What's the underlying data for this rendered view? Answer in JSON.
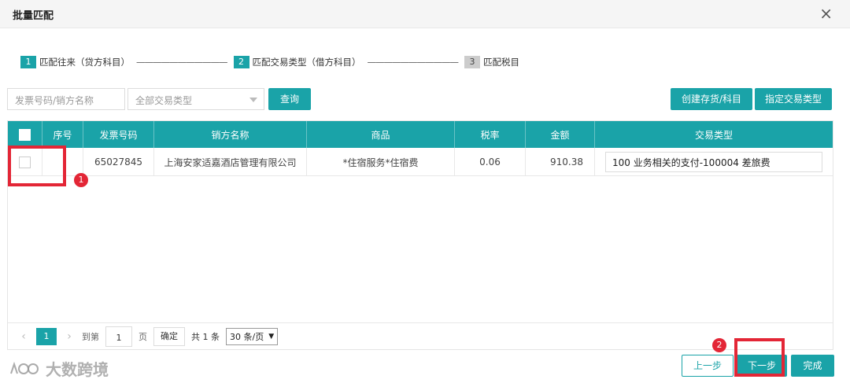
{
  "dialog": {
    "title": "批量匹配",
    "close_glyph": "×"
  },
  "steps": [
    {
      "num": "1",
      "label": "匹配往来（贷方科目）",
      "active": true
    },
    {
      "num": "2",
      "label": "匹配交易类型（借方科目）",
      "active": true
    },
    {
      "num": "3",
      "label": "匹配税目",
      "active": false
    }
  ],
  "step_separator": "———————————",
  "filters": {
    "search_placeholder": "发票号码/销方名称",
    "type_select": "全部交易类型",
    "query_label": "查询",
    "create_label": "创建存货/科目",
    "assign_label": "指定交易类型"
  },
  "table": {
    "columns": [
      "",
      "序号",
      "发票号码",
      "销方名称",
      "商品",
      "税率",
      "金额",
      "交易类型"
    ],
    "rows": [
      {
        "seq": "",
        "invoice_no": "65027845",
        "seller": "上海安家适嘉酒店管理有限公司",
        "goods": "*住宿服务*住宿费",
        "tax_rate": "0.06",
        "amount": "910.38",
        "trade_type": "100 业务相关的支付-100004 差旅费"
      }
    ]
  },
  "pagination": {
    "current": "1",
    "goto_prefix": "到第",
    "goto_value": "1",
    "goto_suffix": "页",
    "confirm_label": "确定",
    "total_text": "共 1 条",
    "page_size": "30 条/页"
  },
  "footer": {
    "prev_label": "上一步",
    "next_label": "下一步",
    "done_label": "完成"
  },
  "annotations": {
    "badge1": "1",
    "badge2": "2"
  },
  "watermark": {
    "text": "大数跨境"
  },
  "colors": {
    "accent": "#1aa3a8",
    "highlight": "#e32636"
  }
}
